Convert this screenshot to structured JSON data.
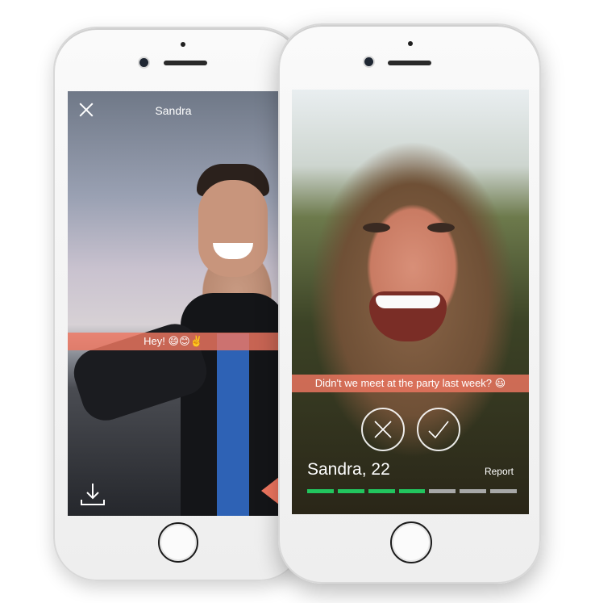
{
  "left_phone": {
    "chat_title": "Sandra",
    "message": "Hey! 😄😊✌️",
    "icons": [
      "close-icon",
      "download-icon",
      "send-arrow-icon"
    ]
  },
  "right_phone": {
    "message": "Didn't we meet at the party last week? 😃",
    "profile_name": "Sandra, 22",
    "report_label": "Report",
    "icons": [
      "reject-icon",
      "accept-icon"
    ],
    "story_progress": {
      "total": 7,
      "completed": 4
    },
    "colors": {
      "accent": "#ef7660",
      "progress_done": "#22c55e",
      "progress_pending": "#a8a8a8"
    }
  }
}
